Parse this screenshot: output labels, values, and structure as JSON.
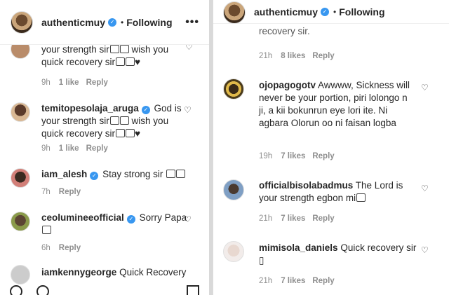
{
  "left": {
    "header": {
      "username": "authenticmuy",
      "separator": "•",
      "follow": "Following",
      "more": "•••"
    },
    "comments": [
      {
        "text_cont": "your strength sir wish you quick recovery sir♥",
        "time": "9h",
        "likes": "1 like",
        "reply": "Reply"
      },
      {
        "username": "temitopesolaja_aruga",
        "text": "God is your strength sir wish you quick recovery sir♥",
        "time": "9h",
        "likes": "1 like",
        "reply": "Reply"
      },
      {
        "username": "iam_alesh",
        "text": "Stay strong sir",
        "time": "7h",
        "reply": "Reply"
      },
      {
        "username": "ceolumineeofficial",
        "text": "Sorry Papa",
        "time": "6h",
        "reply": "Reply"
      },
      {
        "username": "iamkennygeorge",
        "text": "Quick Recovery"
      }
    ]
  },
  "right": {
    "header": {
      "username": "authenticmuy",
      "separator": "•",
      "follow": "Following"
    },
    "comments": [
      {
        "text_cont": "recovery sir.",
        "time": "21h",
        "likes": "8 likes",
        "reply": "Reply"
      },
      {
        "username": "ojopagogotv",
        "text": "Awwww, Sickness will never be your portion, piri lolongo n ji, a kii bokunrun eye lori ite. Ni agbara Olorun oo ni faisan logba",
        "time": "19h",
        "likes": "7 likes",
        "reply": "Reply"
      },
      {
        "username": "officialbisolabadmus",
        "text": "The Lord is your strength egbon mi",
        "time": "21h",
        "likes": "7 likes",
        "reply": "Reply"
      },
      {
        "username": "mimisola_daniels",
        "text": "Quick recovery sir ▯",
        "time": "21h",
        "likes": "7 likes",
        "reply": "Reply"
      }
    ]
  }
}
